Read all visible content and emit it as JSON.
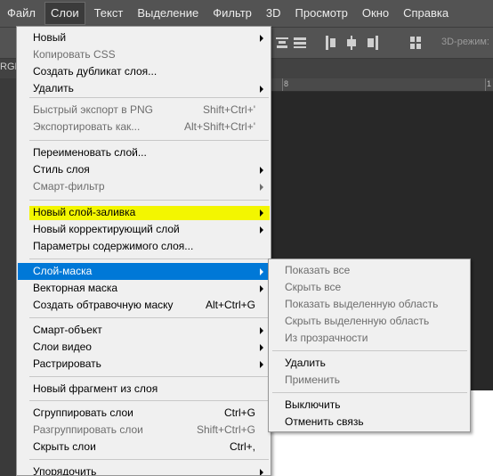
{
  "menubar": {
    "items": [
      "Файл",
      "Слои",
      "Текст",
      "Выделение",
      "Фильтр",
      "3D",
      "Просмотр",
      "Окно",
      "Справка"
    ],
    "active": "Слои"
  },
  "options_bar": {
    "mode_3d": "3D-режим:"
  },
  "doc_tab": {
    "label": "RGE"
  },
  "ruler": {
    "ticks": [
      "8",
      "1"
    ]
  },
  "layer_menu": {
    "groups": [
      [
        {
          "label": "Новый",
          "submenu": true
        },
        {
          "label": "Копировать CSS",
          "disabled": true
        },
        {
          "label": "Создать дубликат слоя..."
        },
        {
          "label": "Удалить",
          "submenu": true
        }
      ],
      [
        {
          "label": "Быстрый экспорт в PNG",
          "shortcut": "Shift+Ctrl+'",
          "disabled": true
        },
        {
          "label": "Экспортировать как...",
          "shortcut": "Alt+Shift+Ctrl+'",
          "disabled": true
        }
      ],
      [
        {
          "label": "Переименовать слой..."
        },
        {
          "label": "Стиль слоя",
          "submenu": true
        },
        {
          "label": "Смарт-фильтр",
          "submenu": true,
          "disabled": true
        }
      ],
      [
        {
          "label": "Новый слой-заливка",
          "submenu": true,
          "highlight": "yellow"
        },
        {
          "label": "Новый корректирующий слой",
          "submenu": true
        },
        {
          "label": "Параметры содержимого слоя..."
        }
      ],
      [
        {
          "label": "Слой-маска",
          "submenu": true,
          "highlight": "blue"
        },
        {
          "label": "Векторная маска",
          "submenu": true
        },
        {
          "label": "Создать обтравочную маску",
          "shortcut": "Alt+Ctrl+G"
        }
      ],
      [
        {
          "label": "Смарт-объект",
          "submenu": true
        },
        {
          "label": "Слои видео",
          "submenu": true
        },
        {
          "label": "Растрировать",
          "submenu": true
        }
      ],
      [
        {
          "label": "Новый фрагмент из слоя"
        }
      ],
      [
        {
          "label": "Сгруппировать слои",
          "shortcut": "Ctrl+G"
        },
        {
          "label": "Разгруппировать слои",
          "shortcut": "Shift+Ctrl+G",
          "disabled": true
        },
        {
          "label": "Скрыть слои",
          "shortcut": "Ctrl+,"
        }
      ],
      [
        {
          "label": "Упорядочить",
          "submenu": true
        }
      ]
    ]
  },
  "mask_submenu": {
    "groups": [
      [
        {
          "label": "Показать все",
          "disabled": true
        },
        {
          "label": "Скрыть все",
          "disabled": true
        },
        {
          "label": "Показать выделенную область",
          "disabled": true
        },
        {
          "label": "Скрыть выделенную область",
          "disabled": true
        },
        {
          "label": "Из прозрачности",
          "disabled": true
        }
      ],
      [
        {
          "label": "Удалить"
        },
        {
          "label": "Применить",
          "disabled": true
        }
      ],
      [
        {
          "label": "Выключить"
        },
        {
          "label": "Отменить связь"
        }
      ]
    ]
  },
  "colors": {
    "highlight_blue": "#0078d7",
    "highlight_yellow": "#f3f600",
    "chrome": "#535353",
    "canvas": "#282828"
  }
}
